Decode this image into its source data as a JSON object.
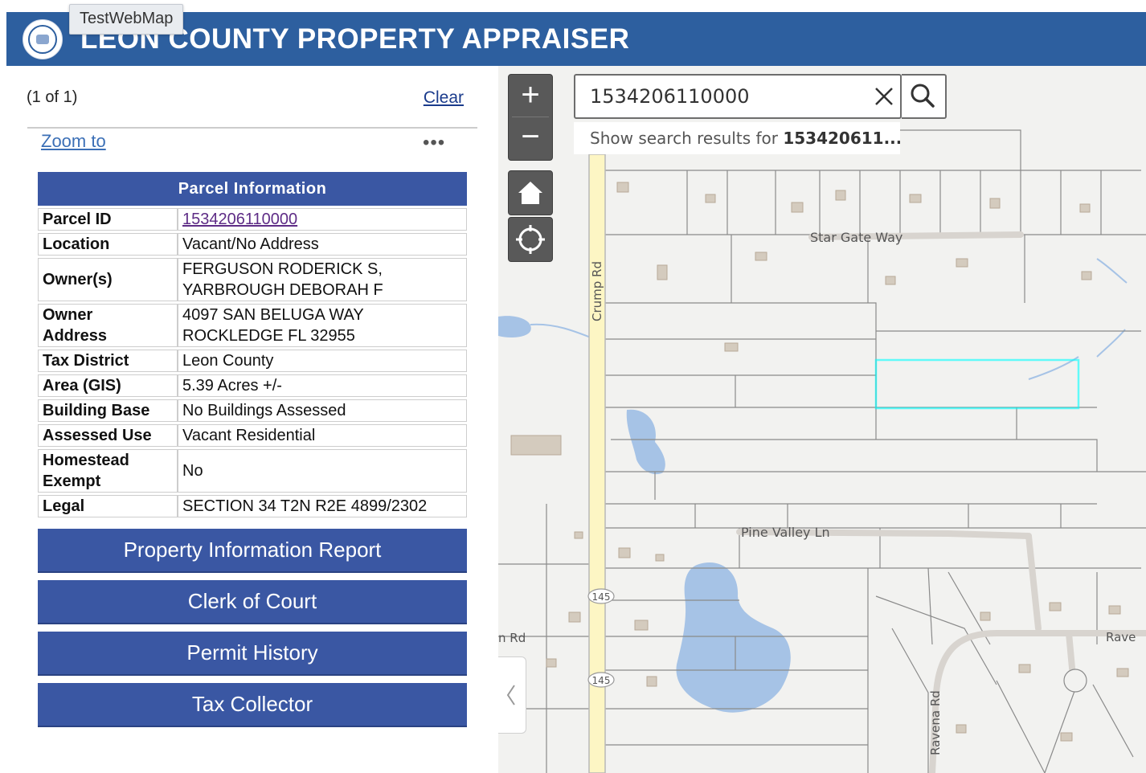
{
  "header": {
    "title": "LEON COUNTY PROPERTY APPRAISER",
    "tooltip": "TestWebMap",
    "logo_icon": "county-seal"
  },
  "panel": {
    "feature_count": "(1 of 1)",
    "clear_label": "Clear",
    "zoom_to_label": "Zoom to",
    "more_menu": "•••",
    "table_title": "Parcel Information",
    "rows": [
      {
        "label": "Parcel ID",
        "value": "1534206110000",
        "link": true
      },
      {
        "label": "Location",
        "value": "Vacant/No Address"
      },
      {
        "label": "Owner(s)",
        "value": "FERGUSON RODERICK S,",
        "value2": "YARBROUGH DEBORAH F"
      },
      {
        "label": "Owner",
        "label2": "Address",
        "value": "4097 SAN BELUGA WAY",
        "value2": "ROCKLEDGE FL 32955"
      },
      {
        "label": "Tax District",
        "value": "Leon County"
      },
      {
        "label": "Area (GIS)",
        "value": "5.39 Acres +/-"
      },
      {
        "label": "Building Base",
        "value": "No Buildings Assessed"
      },
      {
        "label": "Assessed Use",
        "value": "Vacant Residential"
      },
      {
        "label": "Homestead",
        "label2": "Exempt",
        "value": "No"
      },
      {
        "label": "Legal",
        "value": "SECTION 34 T2N R2E 4899/2302"
      }
    ],
    "buttons": [
      {
        "label": "Property Information Report"
      },
      {
        "label": "Clerk of Court"
      },
      {
        "label": "Permit History"
      },
      {
        "label": "Tax Collector"
      }
    ]
  },
  "map": {
    "search": {
      "value": "1534206110000",
      "suggestion_prefix": "Show search results for ",
      "suggestion_term": "153420611..."
    },
    "controls": {
      "zoom_in": "+",
      "zoom_out": "−",
      "home_icon": "home-icon",
      "locate_icon": "locate-icon"
    },
    "labels": {
      "crump_rd": "Crump Rd",
      "star_gate_way": "Star Gate Way",
      "pine_valley_ln": "Pine Valley Ln",
      "ravena_rd": "Ravena Rd",
      "ravena": "Rave",
      "rd_partial": "n Rd",
      "shield_top": "145",
      "shield_bottom": "145"
    },
    "colors": {
      "highlight": "#00ffff",
      "water": "#a6c3e6",
      "building": "#d4cbbe",
      "road": "#fdf6c4"
    }
  }
}
